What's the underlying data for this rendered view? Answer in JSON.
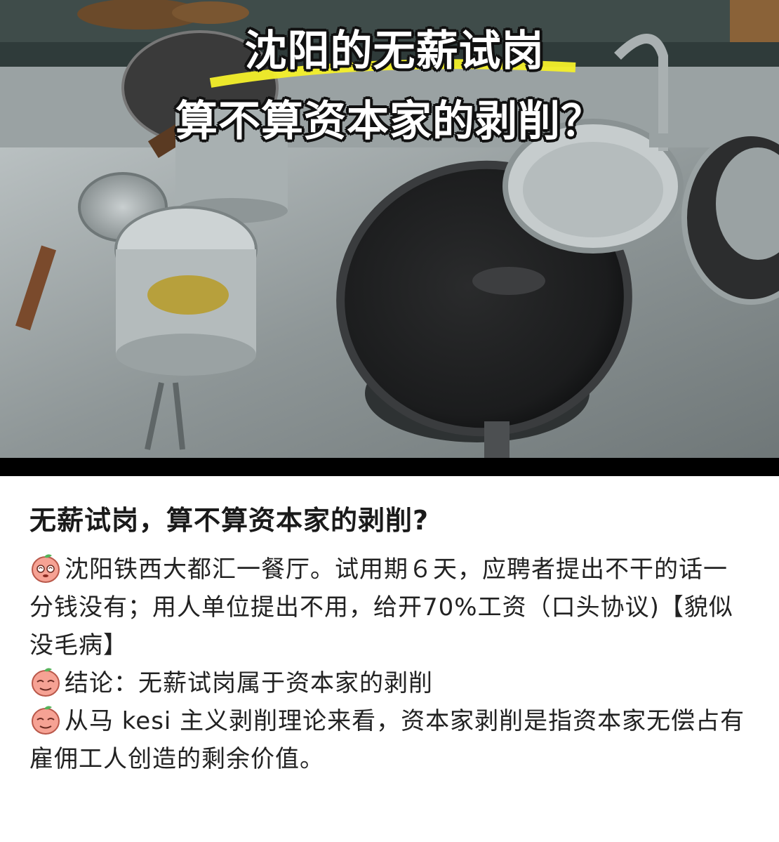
{
  "hero": {
    "title_line1": "沈阳的无薪试岗",
    "title_line2": "算不算资本家的剥削？"
  },
  "post": {
    "title": "无薪试岗，算不算资本家的剥削?",
    "paragraphs": [
      {
        "icon": "peach-face-dizzy-icon",
        "text": "沈阳铁西大都汇一餐厅。试用期６天，应聘者提出不干的话一分钱没有；用人单位提出不用，给开70%工资（口头协议)【貌似没毛病】"
      },
      {
        "icon": "peach-face-smug-icon",
        "text": "结论：无薪试岗属于资本家的剥削"
      },
      {
        "icon": "peach-face-smug-icon",
        "text": "从马 kesi 主义剥削理论来看，资本家剥削是指资本家无偿占有雇佣工人创造的剩余价值。"
      }
    ]
  },
  "colors": {
    "title_text": "#1a1a1a",
    "body_text": "#222222",
    "hero_text": "#ffffff",
    "hero_highlight": "#f4f02a"
  }
}
